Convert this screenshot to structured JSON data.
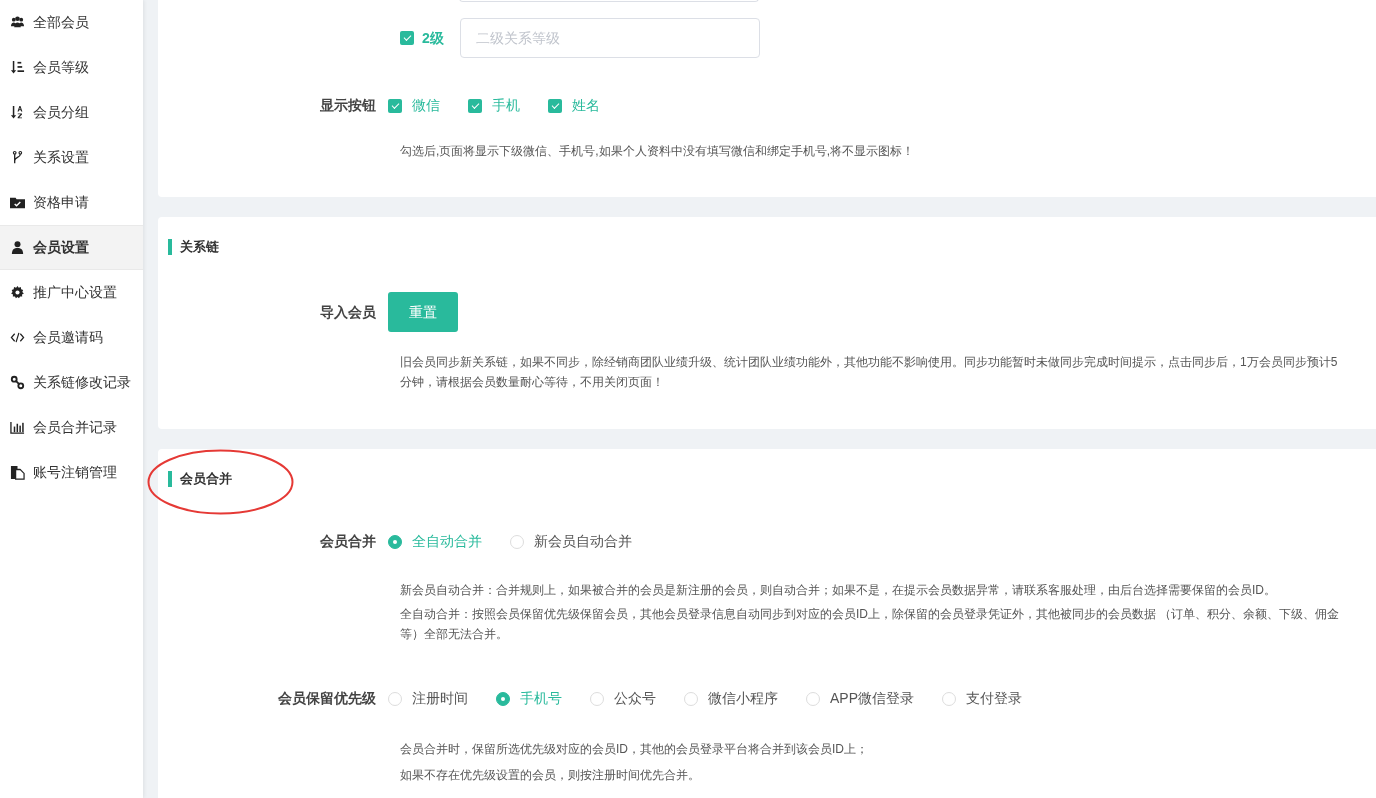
{
  "sidebar": {
    "items": [
      {
        "label": "全部会员",
        "selected": false
      },
      {
        "label": "会员等级",
        "selected": false
      },
      {
        "label": "会员分组",
        "selected": false
      },
      {
        "label": "关系设置",
        "selected": false
      },
      {
        "label": "资格申请",
        "selected": false
      },
      {
        "label": "会员设置",
        "selected": true
      },
      {
        "label": "推广中心设置",
        "selected": false
      },
      {
        "label": "会员邀请码",
        "selected": false
      },
      {
        "label": "关系链修改记录",
        "selected": false
      },
      {
        "label": "会员合并记录",
        "selected": false
      },
      {
        "label": "账号注销管理",
        "selected": false
      }
    ]
  },
  "level_settings": {
    "levels": [
      {
        "label": "2级",
        "checked": true,
        "placeholder": "二级关系等级"
      }
    ],
    "display_buttons": {
      "label": "显示按钮",
      "options": [
        {
          "label": "微信",
          "checked": true
        },
        {
          "label": "手机",
          "checked": true
        },
        {
          "label": "姓名",
          "checked": true
        }
      ]
    },
    "help": "勾选后,页面将显示下级微信、手机号,如果个人资料中没有填写微信和绑定手机号,将不显示图标！"
  },
  "relation_chain": {
    "title": "关系链",
    "import_label": "导入会员",
    "button": "重置",
    "help": "旧会员同步新关系链，如果不同步，除经销商团队业绩升级、统计团队业绩功能外，其他功能不影响使用。同步功能暂时未做同步完成时间提示，点击同步后，1万会员同步预计5分钟，请根据会员数量耐心等待，不用关闭页面！"
  },
  "member_merge": {
    "title": "会员合并",
    "mode": {
      "label": "会员合并",
      "options": [
        {
          "label": "全自动合并",
          "selected": true
        },
        {
          "label": "新会员自动合并",
          "selected": false
        }
      ]
    },
    "mode_help": [
      "新会员自动合并：合并规则上，如果被合并的会员是新注册的会员，则自动合并；如果不是，在提示会员数据异常，请联系客服处理，由后台选择需要保留的会员ID。",
      "全自动合并：按照会员保留优先级保留会员，其他会员登录信息自动同步到对应的会员ID上，除保留的会员登录凭证外，其他被同步的会员数据 （订单、积分、余额、下级、佣金等）全部无法合并。"
    ],
    "priority": {
      "label": "会员保留优先级",
      "options": [
        {
          "label": "注册时间",
          "selected": false
        },
        {
          "label": "手机号",
          "selected": true
        },
        {
          "label": "公众号",
          "selected": false
        },
        {
          "label": "微信小程序",
          "selected": false
        },
        {
          "label": "APP微信登录",
          "selected": false
        },
        {
          "label": "支付登录",
          "selected": false
        }
      ]
    },
    "priority_help": [
      "会员合并时，保留所选优先级对应的会员ID，其他的会员登录平台将合并到该会员ID上；",
      "如果不存在优先级设置的会员，则按注册时间优先合并。"
    ]
  }
}
